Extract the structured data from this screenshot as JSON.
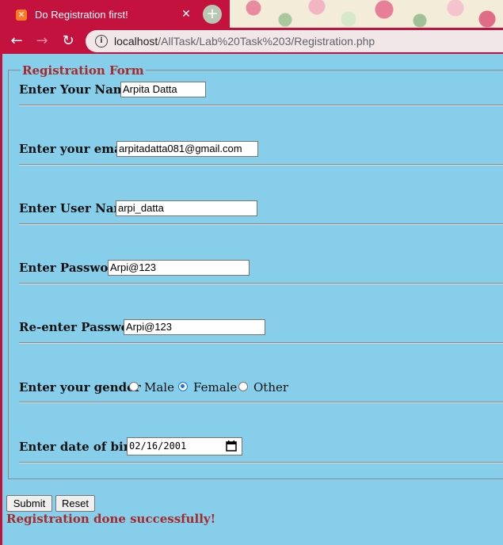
{
  "browser": {
    "tab_title": "Do Registration first!",
    "tab_icon": "xampp-icon",
    "url_host": "localhost",
    "url_path": "/AllTask/Lab%20Task%203/Registration.php"
  },
  "form": {
    "legend": "Registration Form",
    "name_label": "Enter Your Name",
    "name_value": "Arpita Datta",
    "email_label": "Enter your email",
    "email_value": "arpitadatta081@gmail.com",
    "username_label": "Enter User Name",
    "username_value": "arpi_datta",
    "password_label": "Enter Password",
    "password_value": "Arpi@123",
    "repassword_label": "Re-enter Password",
    "repassword_value": "Arpi@123",
    "gender_label": "Enter your gender",
    "gender_options": [
      "Male",
      "Female",
      "Other"
    ],
    "gender_selected": "Female",
    "dob_label": "Enter date of birth",
    "dob_value": "02/16/2001"
  },
  "buttons": {
    "submit": "Submit",
    "reset": "Reset"
  },
  "status_message": "Registration done successfully!",
  "colors": {
    "page_bg": "#87ceeb",
    "browser_accent": "#c4123e",
    "legend_color": "#a52a2a",
    "radio_checked": "#1a73e8"
  }
}
